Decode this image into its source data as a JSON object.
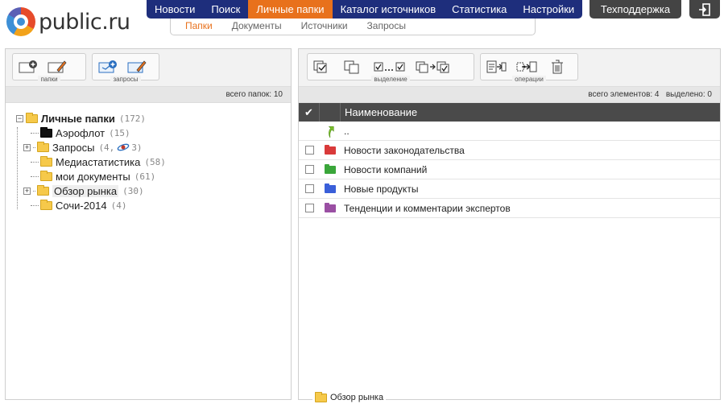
{
  "logo": {
    "text": "public.ru"
  },
  "topnav": [
    "Новости",
    "Поиск",
    "Личные папки",
    "Каталог источников",
    "Статистика",
    "Настройки"
  ],
  "topnav_active": "Личные папки",
  "support": {
    "label": "Техподдержка"
  },
  "subnav": [
    "Папки",
    "Документы",
    "Источники",
    "Запросы"
  ],
  "subnav_active": "Папки",
  "left": {
    "groups": {
      "folders": "папки",
      "queries": "запросы"
    },
    "status": "всего папок: 10",
    "tree": {
      "root": {
        "label": "Личные папки",
        "count": "(172)"
      },
      "children": [
        {
          "label": "Аэрофлот",
          "count": "(15)"
        },
        {
          "label": "Запросы",
          "count": "(4,",
          "count2": "3)"
        },
        {
          "label": "Медиастатистика",
          "count": "(58)"
        },
        {
          "label": "мои документы",
          "count": "(61)"
        },
        {
          "label": "Обзор рынка",
          "count": "(30)"
        },
        {
          "label": "Сочи-2014",
          "count": "(4)"
        }
      ]
    }
  },
  "right": {
    "groups": {
      "selection": "выделение",
      "operations": "операции"
    },
    "status": "всего элементов: 4   выделено: 0",
    "grid": {
      "header": "Наименование",
      "up": "..",
      "rows": [
        {
          "label": "Новости законодательства",
          "color": "#d93a3a"
        },
        {
          "label": "Новости компаний",
          "color": "#3aa63a"
        },
        {
          "label": "Новые продукты",
          "color": "#3a5fd9"
        },
        {
          "label": "Тенденции и комментарии экспертов",
          "color": "#9a4fa3"
        }
      ]
    }
  },
  "footer": {
    "current_folder": "Обзор рынка"
  },
  "colors": {
    "nav_bg": "#1e2e7c",
    "accent": "#e8711c",
    "dark": "#444444"
  }
}
